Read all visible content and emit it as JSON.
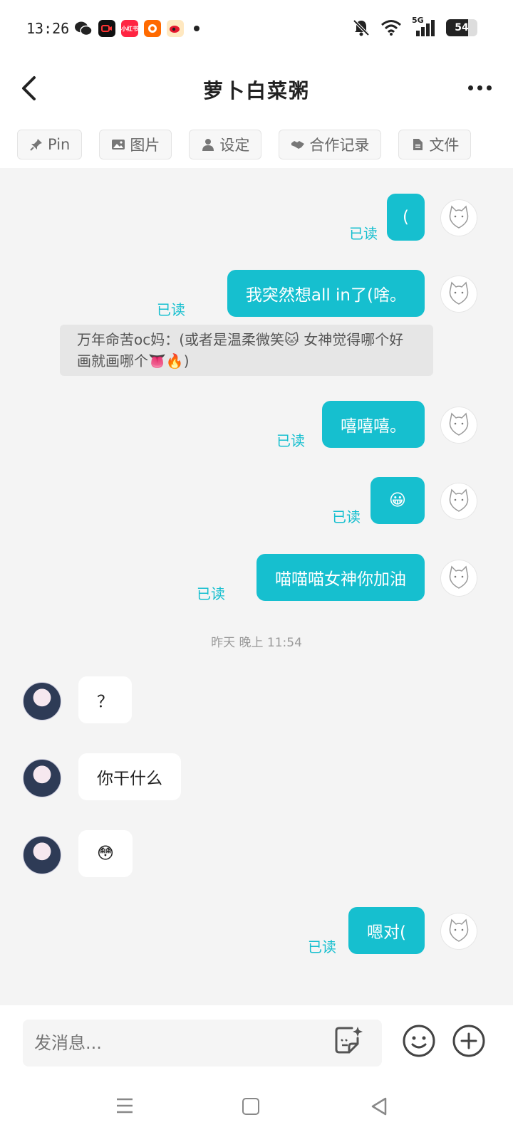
{
  "status_bar": {
    "time": "13:26",
    "apps": [
      "wechat-icon",
      "video-icon",
      "xiaohongshu-icon",
      "taobao-icon",
      "weibo-icon"
    ],
    "xiaohongshu_label": "小红书",
    "network": "5G",
    "battery": "54"
  },
  "header": {
    "title": "萝卜白菜粥"
  },
  "tabs": [
    {
      "label": "Pin",
      "icon": "pin-icon"
    },
    {
      "label": "图片",
      "icon": "image-icon"
    },
    {
      "label": "设定",
      "icon": "person-icon"
    },
    {
      "label": "合作记录",
      "icon": "handshake-icon"
    },
    {
      "label": "文件",
      "icon": "file-icon"
    }
  ],
  "messages": {
    "m1": {
      "text": "(",
      "status": "已读"
    },
    "m2": {
      "text": "我突然想all in了(啥。",
      "status": "已读"
    },
    "quote": {
      "text": "万年命苦oc妈：(或者是温柔微笑🐱 女神觉得哪个好画就画哪个👅🔥)"
    },
    "m3": {
      "text": "嘻嘻嘻。",
      "status": "已读"
    },
    "m4": {
      "text": "😀",
      "status": "已读"
    },
    "m5": {
      "text": "喵喵喵女神你加油",
      "status": "已读"
    },
    "time_separator": "昨天 晚上 11:54",
    "m6": {
      "text": "？"
    },
    "m7": {
      "text": "你干什么"
    },
    "m8": {
      "text": "😳"
    },
    "m9": {
      "text": "嗯对(",
      "status": "已读"
    }
  },
  "input": {
    "placeholder": "发消息..."
  },
  "colors": {
    "accent": "#16bfcf",
    "chat_bg": "#f4f4f4"
  }
}
